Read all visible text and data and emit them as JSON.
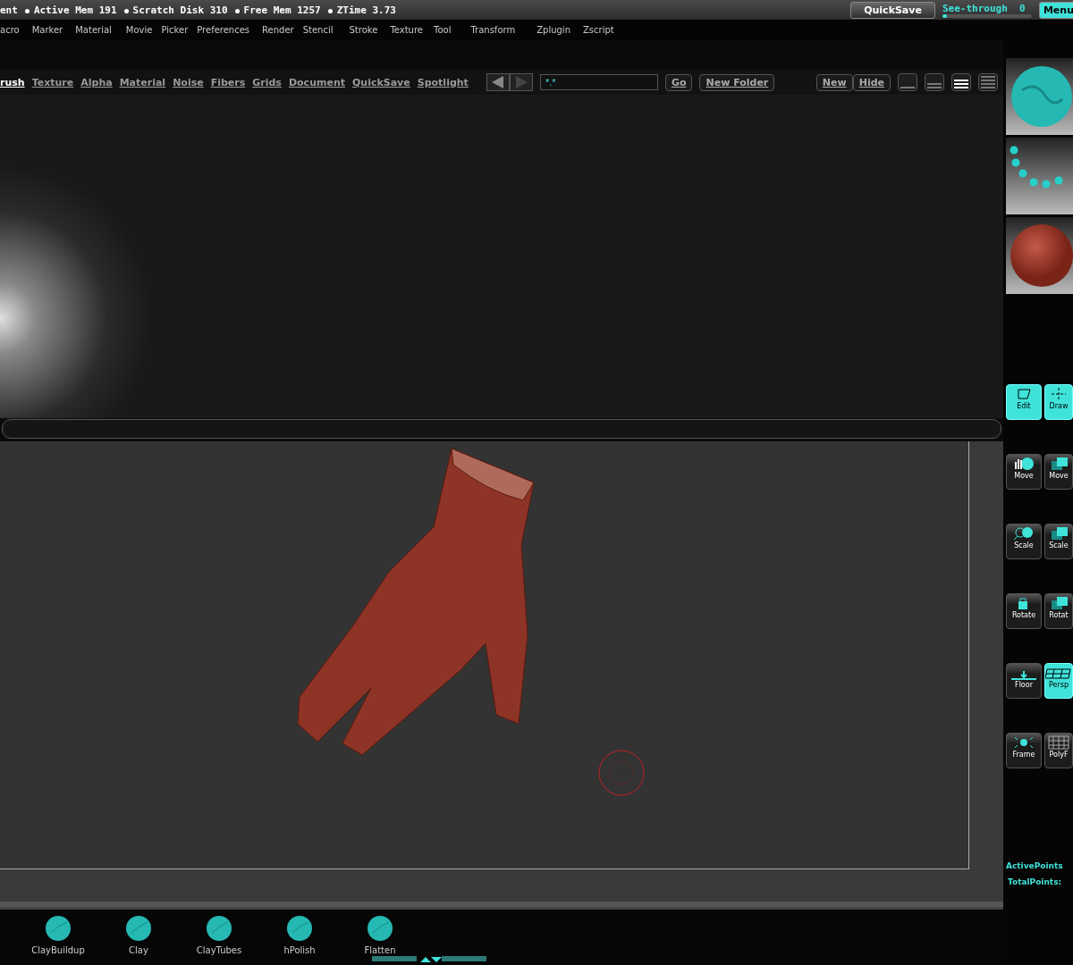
{
  "status_bar": {
    "title": "ent",
    "stats": [
      {
        "label": "Active Mem",
        "value": "191"
      },
      {
        "label": "Scratch Disk",
        "value": "310"
      },
      {
        "label": "Free Mem",
        "value": "1257"
      },
      {
        "label": "ZTime",
        "value": "3.73"
      }
    ],
    "quicksave": "QuickSave",
    "see_through": {
      "label": "See-through",
      "value": "0",
      "level": 0.05
    },
    "menus_button": "Menu"
  },
  "menu": [
    "acro",
    "Marker",
    "Material",
    "Movie",
    "Picker",
    "Preferences",
    "Render",
    "Stencil",
    "Stroke",
    "Texture",
    "Tool",
    "Transform",
    "Zplugin",
    "Zscript"
  ],
  "lightbox": {
    "tabs": [
      {
        "label": "rush",
        "selected": true
      },
      {
        "label": "Texture",
        "selected": false
      },
      {
        "label": "Alpha",
        "selected": false
      },
      {
        "label": "Material",
        "selected": false
      },
      {
        "label": "Noise",
        "selected": false
      },
      {
        "label": "Fibers",
        "selected": false
      },
      {
        "label": "Grids",
        "selected": false
      },
      {
        "label": "Document",
        "selected": false
      },
      {
        "label": "QuickSave",
        "selected": false
      },
      {
        "label": "Spotlight",
        "selected": false
      }
    ],
    "path": "*.*",
    "go": "Go",
    "new_folder": "New Folder",
    "new": "New",
    "hide": "Hide",
    "layouts": [
      {
        "selected": false
      },
      {
        "selected": false
      },
      {
        "selected": true
      },
      {
        "selected": false
      }
    ]
  },
  "right_shelf": {
    "previews": [
      {
        "kind": "brush"
      },
      {
        "kind": "stroke"
      },
      {
        "kind": "material"
      }
    ],
    "buttons": [
      {
        "label": "Edit",
        "on": true
      },
      {
        "label": "Draw",
        "on": true
      },
      {
        "label": "Move",
        "on": false
      },
      {
        "label": "Move",
        "on": false
      },
      {
        "label": "Scale",
        "on": false
      },
      {
        "label": "Scale",
        "on": false
      },
      {
        "label": "Rotate",
        "on": false
      },
      {
        "label": "Rotat",
        "on": false
      },
      {
        "label": "Floor",
        "on": false
      },
      {
        "label": "Persp",
        "on": true
      },
      {
        "label": "Frame",
        "on": false
      },
      {
        "label": "PolyF",
        "on": false
      }
    ],
    "stats": [
      "ActivePoints",
      "TotalPoints:"
    ]
  },
  "brush_shelf": [
    "ClayBuildup",
    "Clay",
    "ClayTubes",
    "hPolish",
    "Flatten"
  ]
}
